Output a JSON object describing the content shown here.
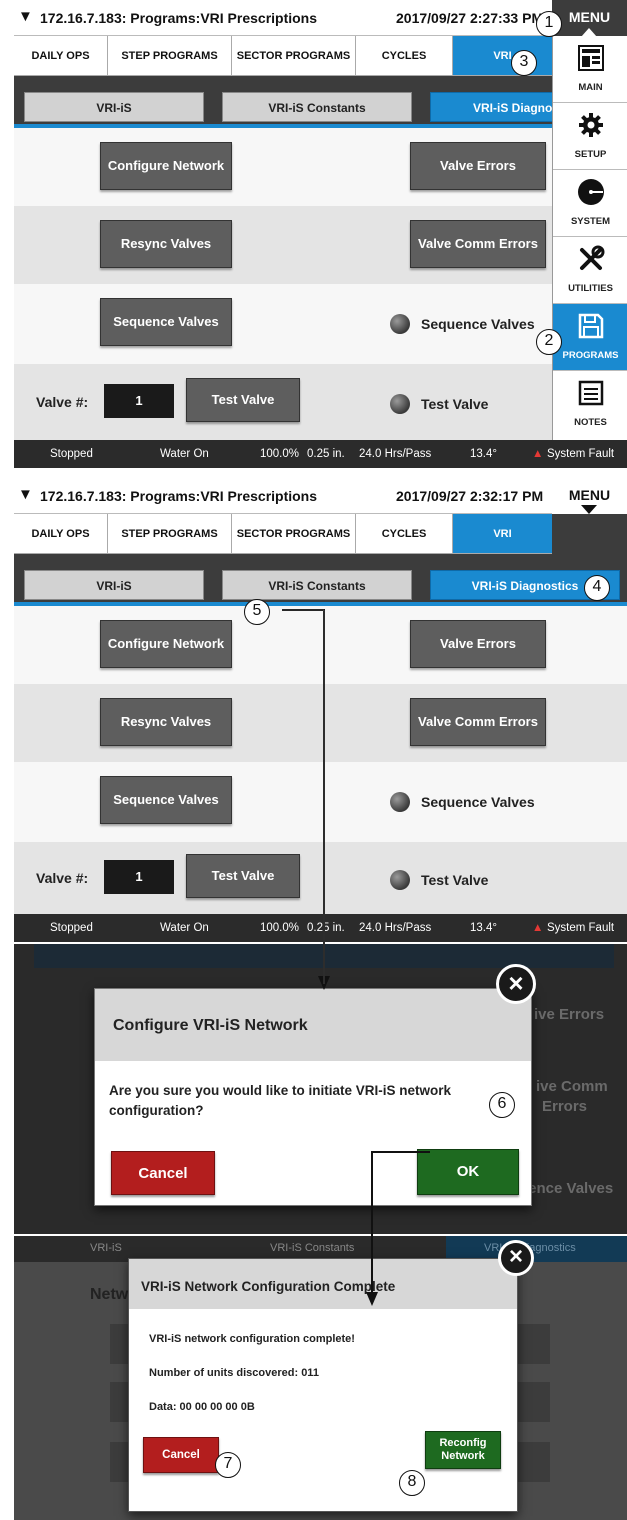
{
  "window": {
    "logo": "▼̸",
    "title": "172.16.7.183: Programs:VRI Prescriptions",
    "time_1": "2017/09/27 2:27:33 PM",
    "time_2": "2017/09/27 2:32:17 PM",
    "menu_label": "MENU"
  },
  "tabs": [
    "DAILY OPS",
    "STEP PROGRAMS",
    "SECTOR PROGRAMS",
    "CYCLES",
    "VRI"
  ],
  "subtabs": [
    "VRI-iS",
    "VRI-iS Constants",
    "VRI-iS Diagnostics"
  ],
  "buttons": {
    "configure_network": "Configure Network",
    "valve_errors": "Valve Errors",
    "resync_valves": "Resync Valves",
    "valve_comm_errors": "Valve Comm Errors",
    "sequence_valves": "Sequence Valves",
    "test_valve": "Test Valve"
  },
  "indicators": {
    "sequence_valves": "Sequence Valves",
    "test_valve": "Test Valve"
  },
  "valve": {
    "label": "Valve #:",
    "value": "1"
  },
  "status_bar": {
    "state": "Stopped",
    "water": "Water On",
    "speed": "100.0%",
    "depth": "0.25 in.",
    "hours": "24.0 Hrs/Pass",
    "angle": "13.4°",
    "fault": "System Fault",
    "fault_icon": "warning-icon"
  },
  "side_menu": [
    {
      "label": "MAIN",
      "icon": "main-icon"
    },
    {
      "label": "SETUP",
      "icon": "gear-icon"
    },
    {
      "label": "SYSTEM",
      "icon": "system-icon"
    },
    {
      "label": "UTILITIES",
      "icon": "tools-icon"
    },
    {
      "label": "PROGRAMS",
      "icon": "save-icon"
    },
    {
      "label": "NOTES",
      "icon": "notes-icon"
    }
  ],
  "confirm_dialog": {
    "title": "Configure VRI-iS Network",
    "message": "Are you sure you would like to initiate VRI-iS network configuration?",
    "cancel": "Cancel",
    "ok": "OK",
    "bg_right_1": "ive Errors",
    "bg_right_2": "ive Comm",
    "bg_right_3": "Errors",
    "bg_right_4": "ience Valves"
  },
  "complete_dialog": {
    "title": "VRI-iS Network Configuration Complete",
    "line1": "VRI-iS network configuration complete!",
    "line2": "Number of units discovered: 011",
    "line3": "Data: 00 00 00 00 0B",
    "cancel": "Cancel",
    "reconfig": "Reconfig Network",
    "bg_left": "Netw"
  },
  "callouts": [
    "1",
    "2",
    "3",
    "4",
    "5",
    "6",
    "7",
    "8"
  ]
}
